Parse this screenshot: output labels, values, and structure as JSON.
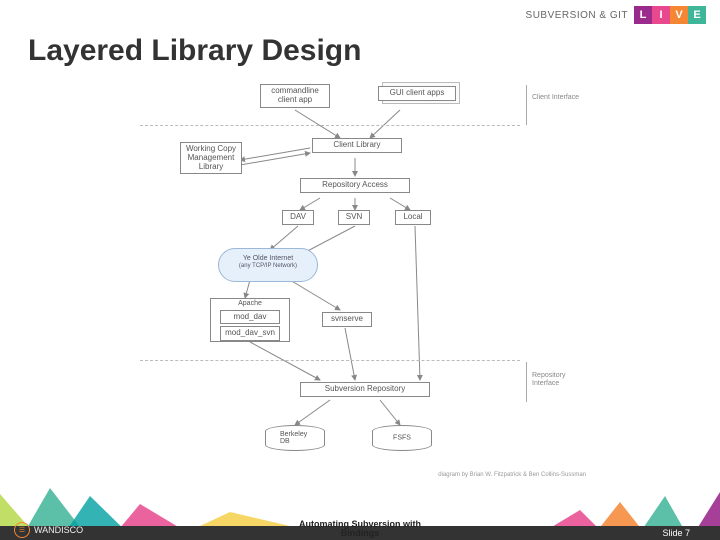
{
  "header": {
    "brand": "SUBVERSION & GIT",
    "live": [
      "L",
      "I",
      "V",
      "E"
    ]
  },
  "title": "Layered Library Design",
  "diagram": {
    "top": {
      "cli": "commandline\nclient app",
      "gui": "GUI client apps",
      "client_iface": "Client\nInterface"
    },
    "client_lib": "Client Library",
    "wc_lib": "Working Copy\nManagement\nLibrary",
    "ra": {
      "label": "Repository Access",
      "dav": "DAV",
      "svn": "SVN",
      "local": "Local"
    },
    "cloud": {
      "title": "Ye Olde Internet",
      "sub": "(any TCP/IP Network)"
    },
    "apache": {
      "label": "Apache",
      "mod_dav": "mod_dav",
      "mod_dav_svn": "mod_dav_svn"
    },
    "svnserve": "svnserve",
    "repo_iface": "Repository\nInterface",
    "repo": "Subversion Repository",
    "bdb": "Berkeley DB",
    "fsfs": "FSFS",
    "attribution": "diagram by Brian W. Fitzpatrick & Ben Collins-Sussman"
  },
  "footer": {
    "logo": "WANDISCO",
    "center_top": "Automating Subversion with",
    "center_bottom": "Bindings",
    "slide": "Slide 7"
  }
}
